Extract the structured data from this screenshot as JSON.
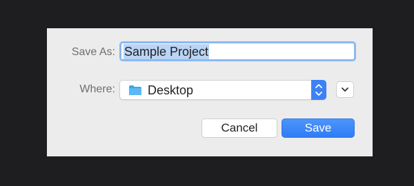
{
  "dialog": {
    "save_as_label": "Save As:",
    "filename_value": "Sample Project",
    "where_label": "Where:",
    "location_value": "Desktop",
    "location_icon": "folder-icon",
    "stepper_icon": "up-down-chevron-icon",
    "expand_icon": "chevron-down-icon",
    "cancel_label": "Cancel",
    "save_label": "Save"
  },
  "colors": {
    "accent": "#3b82f6",
    "selection": "#b9d4f5",
    "dialog_bg": "#ececec",
    "backdrop": "#1e1e20"
  }
}
